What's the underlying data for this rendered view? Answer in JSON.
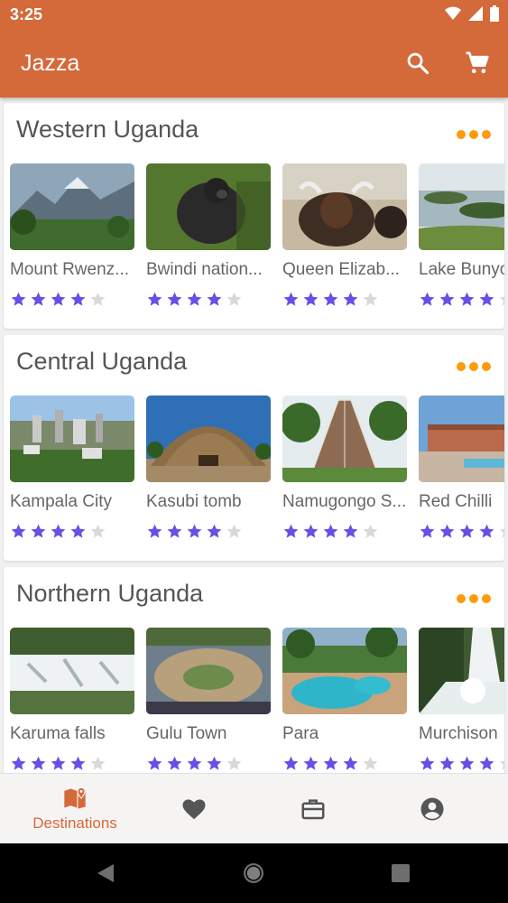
{
  "status": {
    "time": "3:25"
  },
  "app": {
    "title": "Jazza"
  },
  "colors": {
    "primary": "#d4693a",
    "accent_dots": "#ff9a0a",
    "star_filled": "#6b4ee6",
    "star_empty": "#d9d9d9"
  },
  "sections": [
    {
      "title": "Western Uganda",
      "places": [
        {
          "name": "Mount Rwenz...",
          "rating": 4
        },
        {
          "name": "Bwindi nation...",
          "rating": 4
        },
        {
          "name": "Queen Elizab...",
          "rating": 4
        },
        {
          "name": "Lake Bunyo",
          "rating": 4
        }
      ]
    },
    {
      "title": "Central Uganda",
      "places": [
        {
          "name": "Kampala City",
          "rating": 4
        },
        {
          "name": "Kasubi tomb",
          "rating": 4
        },
        {
          "name": "Namugongo S...",
          "rating": 4
        },
        {
          "name": "Red Chilli",
          "rating": 4
        }
      ]
    },
    {
      "title": "Northern Uganda",
      "places": [
        {
          "name": "Karuma falls",
          "rating": 4
        },
        {
          "name": "Gulu Town",
          "rating": 4
        },
        {
          "name": "Para",
          "rating": 4
        },
        {
          "name": "Murchison",
          "rating": 4
        }
      ]
    }
  ],
  "bottom_nav": {
    "destinations_label": "Destinations",
    "active": "destinations",
    "icons": [
      "map-icon",
      "heart-icon",
      "briefcase-icon",
      "account-icon"
    ]
  },
  "icons": {
    "search": "search-icon",
    "cart": "cart-icon"
  }
}
